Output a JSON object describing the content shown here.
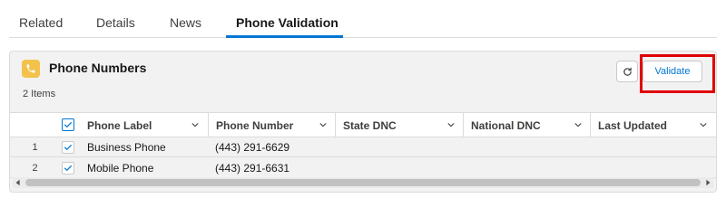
{
  "tabs": [
    {
      "label": "Related"
    },
    {
      "label": "Details"
    },
    {
      "label": "News"
    },
    {
      "label": "Phone Validation",
      "active": true
    }
  ],
  "card": {
    "title": "Phone Numbers",
    "count_text": "2 Items",
    "icon": "phone-icon",
    "icon_color": "#f2c24b",
    "refresh_icon": "refresh-icon",
    "validate_label": "Validate",
    "highlight_color": "#e00000"
  },
  "table": {
    "columns": [
      {
        "label": "Phone Label"
      },
      {
        "label": "Phone Number"
      },
      {
        "label": "State DNC"
      },
      {
        "label": "National DNC"
      },
      {
        "label": "Last Updated"
      }
    ],
    "rows": [
      {
        "num": "1",
        "phone_label": "Business Phone",
        "phone_number": "(443) 291-6629",
        "state_dnc": "",
        "national_dnc": "",
        "last_updated": ""
      },
      {
        "num": "2",
        "phone_label": "Mobile Phone",
        "phone_number": "(443) 291-6631",
        "state_dnc": "",
        "national_dnc": "",
        "last_updated": ""
      }
    ]
  },
  "colors": {
    "accent": "#0176d3",
    "border": "#dddbda",
    "card_bg": "#f3f2f2"
  }
}
